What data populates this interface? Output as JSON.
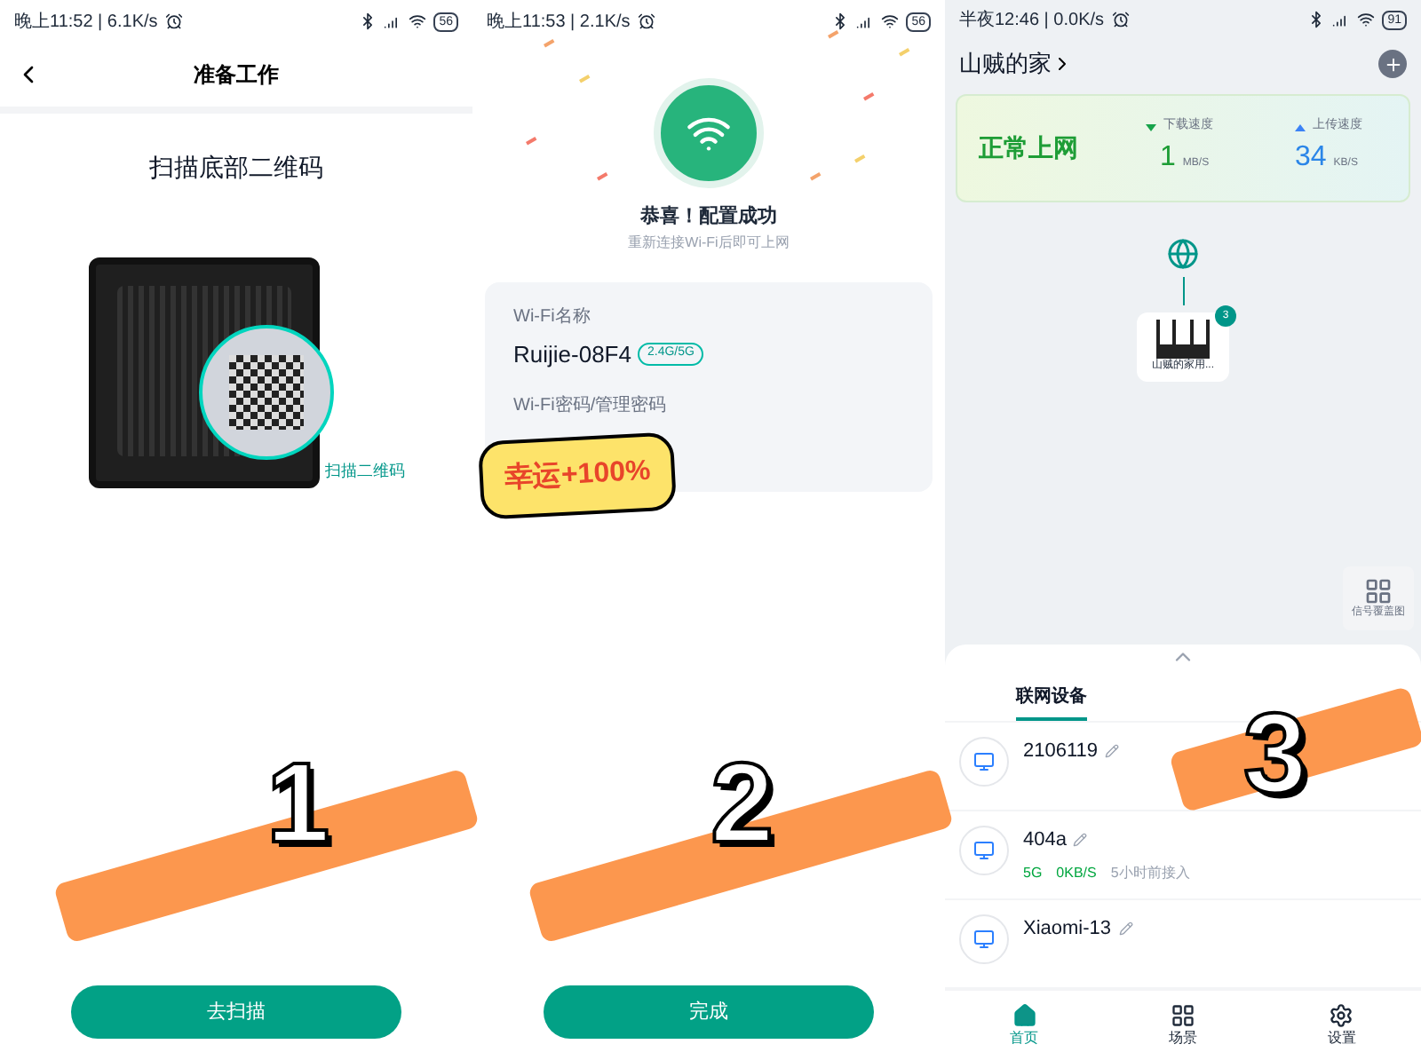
{
  "screens": [
    {
      "kind": "scan",
      "status_bar": {
        "time": "晚上11:52 | 6.1K/s",
        "battery": "56"
      },
      "title": "准备工作",
      "heading": "扫描底部二维码",
      "callout": "扫描二维码",
      "button": "去扫描"
    },
    {
      "kind": "success",
      "status_bar": {
        "time": "晚上11:53 | 2.1K/s",
        "battery": "56"
      },
      "message": "恭喜！配置成功",
      "hint": "重新连接Wi-Fi后即可上网",
      "wifi_name_label": "Wi-Fi名称",
      "wifi_name": "Ruijie-08F4",
      "band_badge": "2.4G/5G",
      "password_label": "Wi-Fi密码/管理密码",
      "button": "完成"
    },
    {
      "kind": "home",
      "status_bar": {
        "time": "半夜12:46 | 0.0K/s",
        "battery": "91"
      },
      "home_name": "山贼的家",
      "status_text": "正常上网",
      "download": {
        "label": "下载速度",
        "value": "1",
        "unit": "MB/S"
      },
      "upload": {
        "label": "上传速度",
        "value": "34",
        "unit": "KB/S"
      },
      "router_label": "山贼的家用...",
      "router_badge": "3",
      "coverage_label": "信号覆盖图",
      "tabs": [
        {
          "label": "联网设备",
          "selected": true
        }
      ],
      "devices": [
        {
          "name": "2106119"
        },
        {
          "name": "404a",
          "band": "5G",
          "speed": "0KB/S",
          "time": "5小时前接入"
        },
        {
          "name": "Xiaomi-13"
        }
      ],
      "nav": [
        {
          "label": "首页",
          "selected": true
        },
        {
          "label": "场景",
          "selected": false
        },
        {
          "label": "设置",
          "selected": false
        }
      ]
    }
  ],
  "stickers": [
    {
      "label": "1"
    },
    {
      "label": "2"
    },
    {
      "label": "3"
    }
  ],
  "lucky_sticker": "幸运+100%"
}
